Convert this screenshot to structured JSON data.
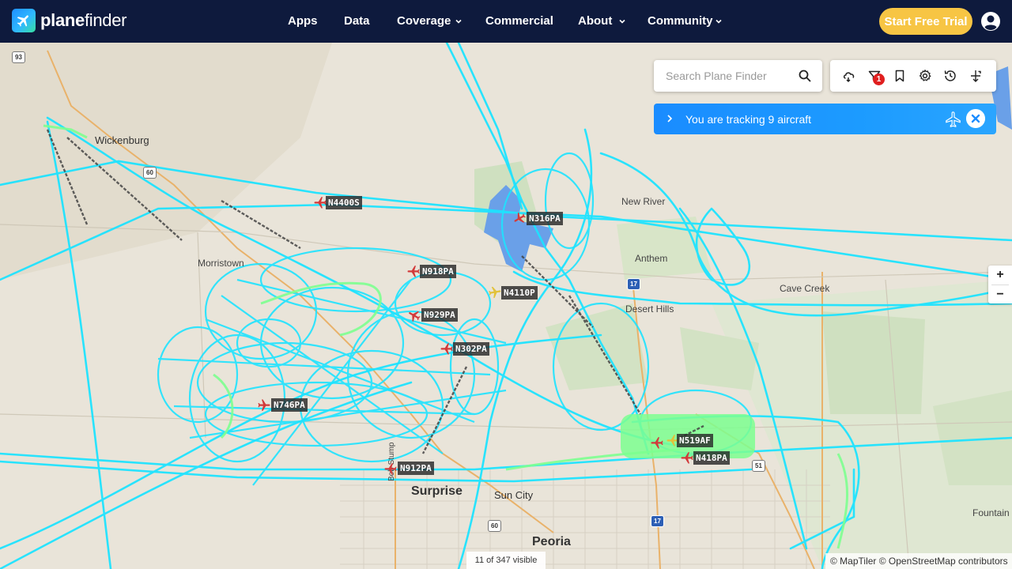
{
  "brand": {
    "name_bold": "plane",
    "name_light": "finder"
  },
  "nav": {
    "items": [
      {
        "label": "Apps",
        "has_dropdown": false
      },
      {
        "label": "Data",
        "has_dropdown": false
      },
      {
        "label": "Coverage",
        "has_dropdown": true
      },
      {
        "label": "Commercial",
        "has_dropdown": false
      },
      {
        "label": "About",
        "has_dropdown": true
      },
      {
        "label": "Community",
        "has_dropdown": true
      }
    ],
    "cta_label": "Start Free Trial"
  },
  "search": {
    "placeholder": "Search Plane Finder"
  },
  "toolbar": {
    "tools": [
      "weather-icon",
      "filter-icon",
      "bookmark-icon",
      "settings-icon",
      "history-icon",
      "playback-icon"
    ],
    "filter_badge": "1"
  },
  "tracking": {
    "message": "You are tracking 9 aircraft"
  },
  "zoom": {
    "in_label": "+",
    "out_label": "−"
  },
  "status": {
    "visible_count": "11 of 347 visible",
    "attribution": "© MapTiler © OpenStreetMap contributors"
  },
  "map": {
    "places": [
      {
        "name": "Wickenburg",
        "size": "mid"
      },
      {
        "name": "New River",
        "size": "small"
      },
      {
        "name": "Anthem",
        "size": "small"
      },
      {
        "name": "Desert Hills",
        "size": "small"
      },
      {
        "name": "Cave Creek",
        "size": "small"
      },
      {
        "name": "Surprise",
        "size": "big"
      },
      {
        "name": "Sun City",
        "size": "mid"
      },
      {
        "name": "Peoria",
        "size": "big"
      },
      {
        "name": "Fountain",
        "size": "small"
      },
      {
        "name": "Morristown",
        "size": "small"
      },
      {
        "name": "Bob Stump",
        "size": "small"
      }
    ],
    "shields": [
      "93",
      "60",
      "60",
      "17",
      "17",
      "51"
    ],
    "aircraft": [
      {
        "callsign": "N4400S",
        "color": "#d23a3a"
      },
      {
        "callsign": "N316PA",
        "color": "#d23a3a"
      },
      {
        "callsign": "N918PA",
        "color": "#d23a3a"
      },
      {
        "callsign": "N4110P",
        "color": "#e2c23a"
      },
      {
        "callsign": "N929PA",
        "color": "#d23a3a"
      },
      {
        "callsign": "N302PA",
        "color": "#d23a3a"
      },
      {
        "callsign": "N746PA",
        "color": "#d23a3a"
      },
      {
        "callsign": "N912PA",
        "color": "#d23a3a"
      },
      {
        "callsign": "N519AF",
        "color": "#e2c23a"
      },
      {
        "callsign": "N418PA",
        "color": "#d23a3a"
      }
    ],
    "colors": {
      "track": "#1ee3ff",
      "track_active": "#7dff8f",
      "water": "#6aa0e8"
    }
  }
}
